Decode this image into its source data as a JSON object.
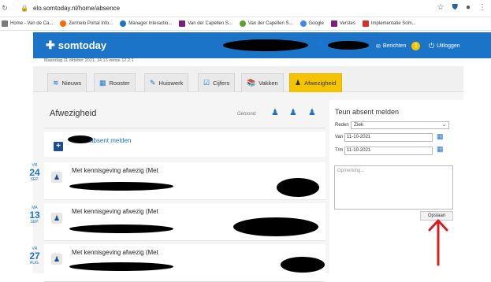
{
  "browser": {
    "url": "elo.somtoday.nl/home/absence",
    "bookmarks": [
      {
        "label": "Home - Van de Ca...",
        "color": "#7a7a7a"
      },
      {
        "label": "Zermelo Portal Info...",
        "color": "#ff6a00"
      },
      {
        "label": "Manager Interactio...",
        "color": "#1b74c7"
      },
      {
        "label": "Van der Capellen S...",
        "color": "#7a1f7a"
      },
      {
        "label": "Van der Capellen S...",
        "color": "#5aa02c"
      },
      {
        "label": "Google",
        "color": "#4285f4"
      },
      {
        "label": "Verstes",
        "color": "#7a1f7a"
      },
      {
        "label": "Implementatie Som...",
        "color": "#d0312d"
      }
    ]
  },
  "header": {
    "brand": "somtoday",
    "berichten_label": "Berichten",
    "berichten_count": "1",
    "logout_label": "Uitloggen",
    "brand_color": "#1b74c7"
  },
  "subheader": {
    "info": "Maandag 11 oktober 2021, 14:13 versie 12.2.1"
  },
  "tabs": [
    {
      "label": "Nieuws",
      "icon": "rss-icon"
    },
    {
      "label": "Rooster",
      "icon": "calendar-icon"
    },
    {
      "label": "Huiswerk",
      "icon": "pencil-icon"
    },
    {
      "label": "Cijfers",
      "icon": "checklist-icon"
    },
    {
      "label": "Vakken",
      "icon": "books-icon"
    },
    {
      "label": "Afwezigheid",
      "icon": "absence-icon",
      "active": true
    }
  ],
  "absences": {
    "title": "Afwezigheid",
    "filter_label": "Getoond:",
    "add_label": "absent melden",
    "items": [
      {
        "weekday": "VR",
        "day": "24",
        "month": "SEP.",
        "text": "Met kennisgeving afwezig (Met"
      },
      {
        "weekday": "MA",
        "day": "13",
        "month": "SEP.",
        "text": "Met kennisgeving afwezig (Met"
      },
      {
        "weekday": "VR",
        "day": "27",
        "month": "AUG.",
        "text": "Met kennisgeving afwezig (Met"
      }
    ]
  },
  "form": {
    "title": "Teun absent melden",
    "reason_label": "Reden",
    "reason_value": "Ziek",
    "from_label": "Van",
    "from_value": "11-10-2021",
    "to_label": "T/m",
    "to_value": "11-10-2021",
    "remark_placeholder": "Opmerking...",
    "save_label": "Opslaan"
  },
  "annotation_color": "#d81e1e"
}
